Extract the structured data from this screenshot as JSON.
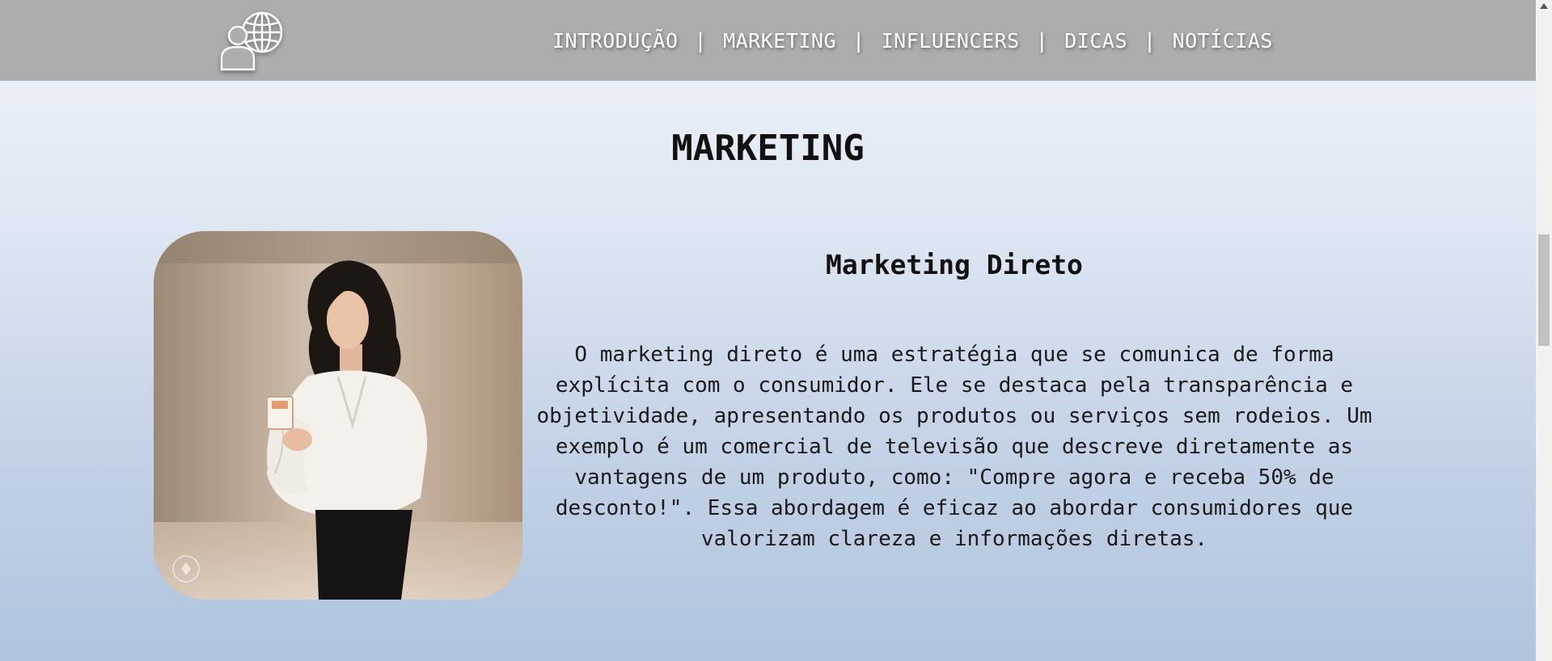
{
  "nav": {
    "items": [
      {
        "label": "INTRODUÇÃO"
      },
      {
        "label": "MARKETING"
      },
      {
        "label": "INFLUENCERS"
      },
      {
        "label": "DICAS"
      },
      {
        "label": "NOTÍCIAS"
      }
    ],
    "separator": "|",
    "logo_icon": "person-globe-icon"
  },
  "section": {
    "title": "MARKETING",
    "subtitle": "Marketing Direto",
    "paragraph": "O marketing direto é uma estratégia que se comunica de forma explícita com o consumidor. Ele se destaca pela transparência e objetividade, apresentando os produtos ou serviços sem rodeios. Um exemplo é um comercial de televisão que descreve diretamente as vantagens de um produto, como: \"Compre agora e receba 50% de desconto!\". Essa abordagem é eficaz ao abordar consumidores que valorizam clareza e informações diretas.",
    "image": "woman-holding-product-photo"
  },
  "colors": {
    "navbar": "#acadaf",
    "nav_text": "#ffffff",
    "heading": "#111111",
    "bg_top": "#f2f5fb",
    "bg_bottom": "#b0c4de"
  }
}
